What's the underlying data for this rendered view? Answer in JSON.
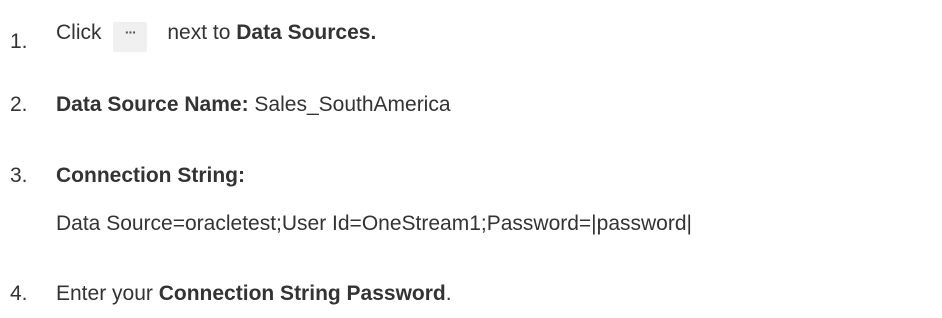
{
  "steps": [
    {
      "number": "1.",
      "prefix": "Click",
      "icon": "ellipsis-more-icon",
      "icon_glyph": "···",
      "middle": "next to",
      "bold": "Data Sources."
    },
    {
      "number": "2.",
      "bold": "Data Source Name:",
      "value": "Sales_SouthAmerica"
    },
    {
      "number": "3.",
      "bold": "Connection String:",
      "value": "Data Source=oracletest;User Id=OneStream1;Password=|password|"
    },
    {
      "number": "4.",
      "prefix": "Enter your",
      "bold": "Connection String Password",
      "suffix": "."
    }
  ]
}
